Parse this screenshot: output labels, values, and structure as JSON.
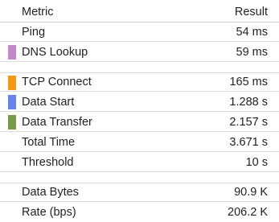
{
  "header": {
    "metric_label": "Metric",
    "result_label": "Result"
  },
  "rows": [
    {
      "label": "Ping",
      "value": "54 ms",
      "color": ""
    },
    {
      "label": "DNS Lookup",
      "value": "59 ms",
      "color": "#c28ac8"
    },
    {
      "label": "TCP Connect",
      "value": "165 ms",
      "color": "#f39a12"
    },
    {
      "label": "Data Start",
      "value": "1.288 s",
      "color": "#6a82ee"
    },
    {
      "label": "Data Transfer",
      "value": "2.157 s",
      "color": "#7a9c4a"
    },
    {
      "label": "Total Time",
      "value": "3.671 s",
      "color": ""
    },
    {
      "label": "Threshold",
      "value": "10 s",
      "color": ""
    },
    {
      "label": "Data Bytes",
      "value": "90.9 K",
      "color": ""
    },
    {
      "label": "Rate (bps)",
      "value": "206.2 K",
      "color": ""
    }
  ]
}
